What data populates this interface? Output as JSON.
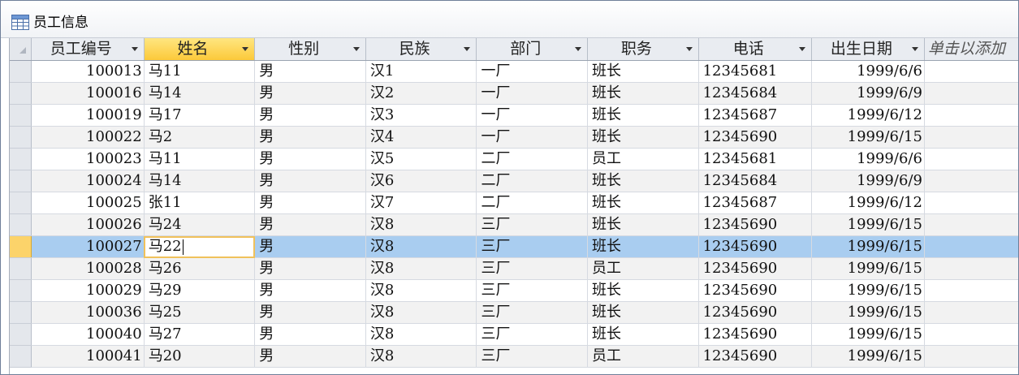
{
  "window": {
    "title": "员工信息"
  },
  "grid": {
    "columns": [
      "员工编号",
      "姓名",
      "性别",
      "民族",
      "部门",
      "职务",
      "电话",
      "出生日期"
    ],
    "add_column_label": "单击以添加",
    "selected_column_index": 1,
    "active_row_index": 8,
    "rows": [
      [
        "100013",
        "马11",
        "男",
        "汉1",
        "一厂",
        "班长",
        "12345681",
        "1999/6/6"
      ],
      [
        "100016",
        "马14",
        "男",
        "汉2",
        "一厂",
        "班长",
        "12345684",
        "1999/6/9"
      ],
      [
        "100019",
        "马17",
        "男",
        "汉3",
        "一厂",
        "班长",
        "12345687",
        "1999/6/12"
      ],
      [
        "100022",
        "马2",
        "男",
        "汉4",
        "一厂",
        "班长",
        "12345690",
        "1999/6/15"
      ],
      [
        "100023",
        "马11",
        "男",
        "汉5",
        "二厂",
        "员工",
        "12345681",
        "1999/6/6"
      ],
      [
        "100024",
        "马14",
        "男",
        "汉6",
        "二厂",
        "班长",
        "12345684",
        "1999/6/9"
      ],
      [
        "100025",
        "张11",
        "男",
        "汉7",
        "二厂",
        "班长",
        "12345687",
        "1999/6/12"
      ],
      [
        "100026",
        "马24",
        "男",
        "汉8",
        "三厂",
        "班长",
        "12345690",
        "1999/6/15"
      ],
      [
        "100027",
        "马22",
        "男",
        "汉8",
        "三厂",
        "班长",
        "12345690",
        "1999/6/15"
      ],
      [
        "100028",
        "马26",
        "男",
        "汉8",
        "三厂",
        "员工",
        "12345690",
        "1999/6/15"
      ],
      [
        "100029",
        "马29",
        "男",
        "汉8",
        "三厂",
        "班长",
        "12345690",
        "1999/6/15"
      ],
      [
        "100036",
        "马25",
        "男",
        "汉8",
        "三厂",
        "班长",
        "12345690",
        "1999/6/15"
      ],
      [
        "100040",
        "马27",
        "男",
        "汉8",
        "三厂",
        "班长",
        "12345690",
        "1999/6/15"
      ],
      [
        "100041",
        "马20",
        "男",
        "汉8",
        "三厂",
        "员工",
        "12345690",
        "1999/6/15"
      ]
    ]
  },
  "icons": {
    "tab": "table-icon",
    "dropdown": "dropdown-arrow-icon"
  },
  "colors": {
    "selected_header": "#fcc93a",
    "active_row": "#a9cdf0",
    "active_row_selector": "#fcd36a",
    "edit_cell_border": "#f0c15b"
  }
}
